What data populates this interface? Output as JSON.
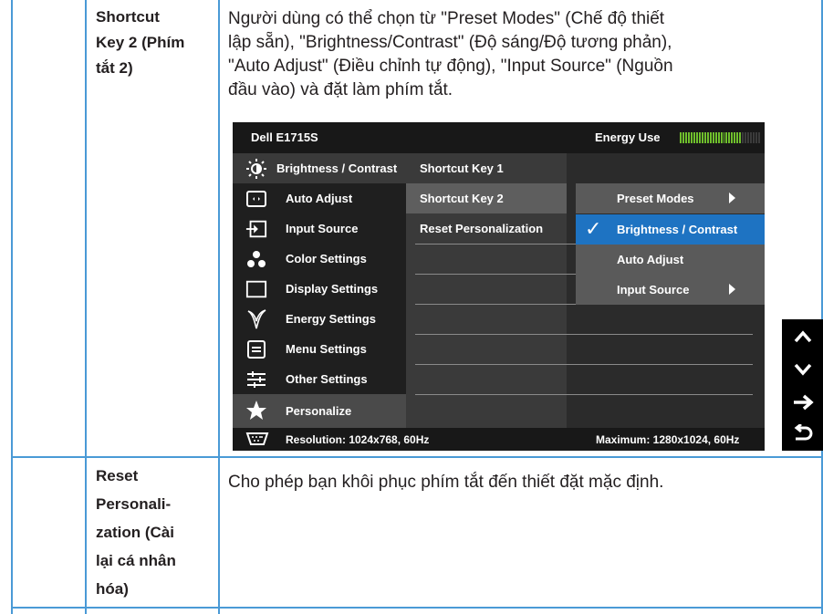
{
  "rows": [
    {
      "term_lines": [
        "Shortcut",
        "Key 2 (Phím",
        "tắt 2)"
      ],
      "desc_lines": [
        "Người dùng có thể chọn từ \"Preset Modes\" (Chế độ thiết",
        "lập sẵn), \"Brightness/Contrast\" (Độ sáng/Độ tương phản),",
        "\"Auto Adjust\" (Điều chỉnh tự động), \"Input Source\" (Nguồn",
        "đầu vào) và đặt làm phím tắt."
      ]
    },
    {
      "term_lines": [
        "Reset",
        "Personali-",
        "zation (Cài",
        "lại cá nhân",
        "hóa)"
      ],
      "desc_lines": [
        "Cho phép bạn khôi phục phím tắt đến thiết đặt mặc định."
      ]
    }
  ],
  "osd": {
    "model": "Dell E1715S",
    "energy_label": "Energy Use",
    "energy_level": 0.75,
    "menu": [
      {
        "label": "Brightness / Contrast",
        "icon": "brightness-icon"
      },
      {
        "label": "Auto Adjust",
        "icon": "auto-adjust-icon"
      },
      {
        "label": "Input Source",
        "icon": "input-source-icon"
      },
      {
        "label": "Color Settings",
        "icon": "color-settings-icon"
      },
      {
        "label": "Display Settings",
        "icon": "display-settings-icon"
      },
      {
        "label": "Energy Settings",
        "icon": "energy-settings-icon"
      },
      {
        "label": "Menu Settings",
        "icon": "menu-settings-icon"
      },
      {
        "label": "Other Settings",
        "icon": "other-settings-icon"
      },
      {
        "label": "Personalize",
        "icon": "star-icon"
      }
    ],
    "submenu": [
      "Shortcut Key 1",
      "Shortcut Key 2",
      "Reset Personalization"
    ],
    "options": [
      {
        "label": "Preset Modes",
        "arrow": true
      },
      {
        "label": "Brightness / Contrast",
        "selected": true
      },
      {
        "label": "Auto Adjust"
      },
      {
        "label": "Input Source",
        "arrow": true
      }
    ],
    "resolution": "Resolution: 1024x768, 60Hz",
    "maximum": "Maximum: 1280x1024, 60Hz",
    "colors": {
      "highlight": "#1e73c2",
      "energy_on": "#6fbf2c"
    }
  },
  "nav_buttons": [
    "up-arrow-icon",
    "down-arrow-icon",
    "right-arrow-icon",
    "back-icon"
  ]
}
